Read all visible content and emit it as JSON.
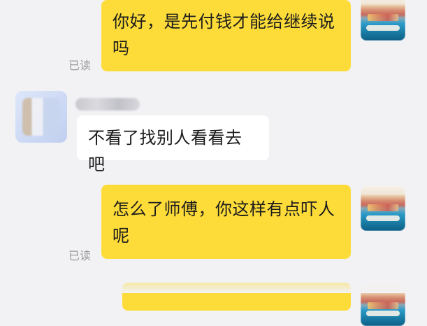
{
  "messages": [
    {
      "id": "m1",
      "from": "me",
      "lines": [
        "你好，是先付钱才能给继续说",
        "吗"
      ],
      "status": "已读"
    },
    {
      "id": "m2",
      "from": "other",
      "text": "不看了找别人看看去吧"
    },
    {
      "id": "m3",
      "from": "me",
      "lines": [
        "怎么了师傅，你这样有点吓人",
        "呢"
      ],
      "status": "已读"
    }
  ],
  "colors": {
    "background": "#f2f2f5",
    "my_bubble": "#fddc3a",
    "other_bubble": "#ffffff",
    "read_tag": "#9a9a9a"
  },
  "icons": {
    "my_avatar": "scenic-coast-avatar-icon",
    "other_avatar": "blurred-profile-avatar-icon"
  }
}
